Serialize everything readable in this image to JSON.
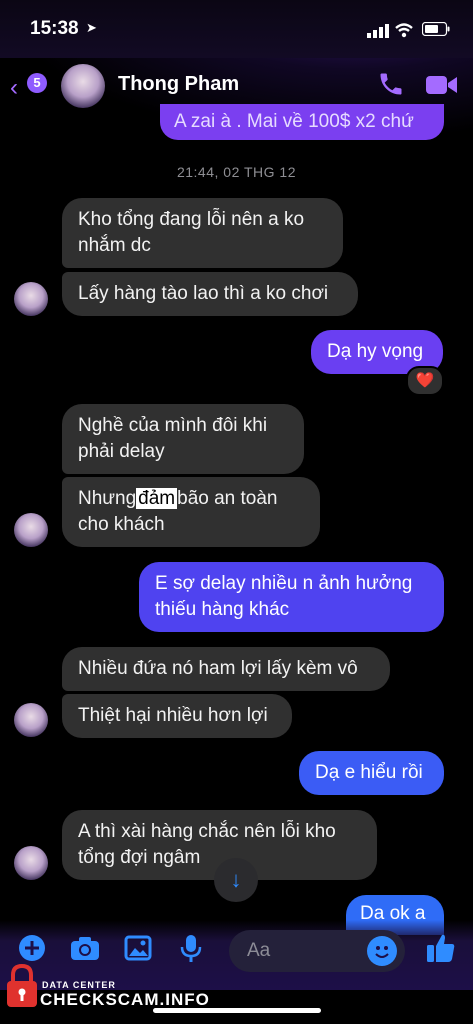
{
  "status_bar": {
    "time": "15:38"
  },
  "header": {
    "back_count": "5",
    "contact_name": "Thong Pham"
  },
  "messages": {
    "top_partial": "A zai à . Mai về 100$ x2 chứ",
    "timestamp": "21:44, 02 THG 12",
    "m1": "Kho tổng đang lỗi nên a ko nhắm dc",
    "m2": "Lấy hàng tào lao thì a ko chơi",
    "m3": "Dạ hy vọng",
    "m3_reaction": "❤️",
    "m4": "Nghề của mình đôi khi phải delay",
    "m5_before": "Nhưng",
    "m5_highlight": "đảm",
    "m5_after": "bão an toàn cho khách",
    "m6": "E sợ delay nhiều n ảnh hưởng thiếu hàng khác",
    "m7": "Nhiều đứa nó ham lợi lấy kèm vô",
    "m8": "Thiệt hại nhiều hơn lợi",
    "m9": "Dạ e hiểu rồi",
    "m10": "A thì xài hàng chắc nên lỗi kho tổng đợi ngâm",
    "m11_partial": "Da ok a"
  },
  "composer": {
    "placeholder": "Aa"
  },
  "watermark": {
    "top": "DATA CENTER",
    "main": "CHECKSCAM.INFO"
  },
  "colors": {
    "accent": "#8f5cff",
    "blue": "#2f8cff",
    "incoming": "#303030"
  }
}
